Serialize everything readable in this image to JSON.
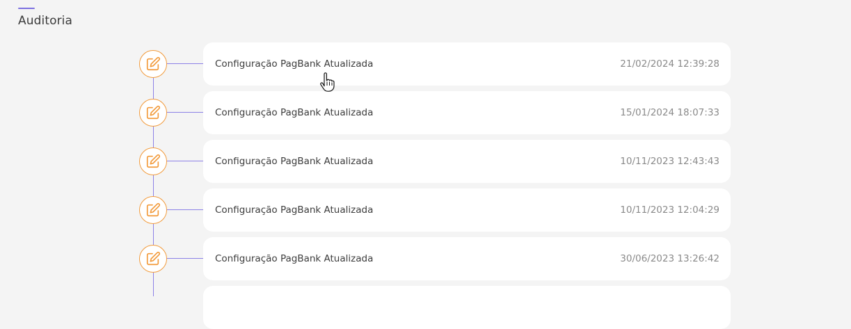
{
  "section": {
    "title": "Auditoria",
    "accent_color": "#7c6fe0"
  },
  "timeline": {
    "line_color": "#8b80e6",
    "icon_color": "#f29a3a",
    "icon_name": "edit-icon",
    "entries": [
      {
        "title": "Configuração PagBank Atualizada",
        "date": "21/02/2024 12:39:28"
      },
      {
        "title": "Configuração PagBank Atualizada",
        "date": "15/01/2024 18:07:33"
      },
      {
        "title": "Configuração PagBank Atualizada",
        "date": "10/11/2023 12:43:43"
      },
      {
        "title": "Configuração PagBank Atualizada",
        "date": "10/11/2023 12:04:29"
      },
      {
        "title": "Configuração PagBank Atualizada",
        "date": "30/06/2023 13:26:42"
      },
      {
        "title": "",
        "date": ""
      }
    ]
  },
  "cursor": {
    "icon_name": "hand-pointer-icon"
  }
}
